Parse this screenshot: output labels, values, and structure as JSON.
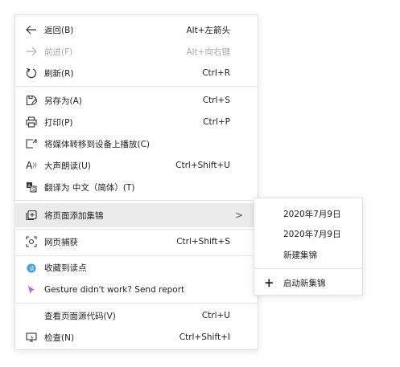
{
  "menu": {
    "back": {
      "label": "返回(B)",
      "shortcut": "Alt+左箭头"
    },
    "forward": {
      "label": "前进(F)",
      "shortcut": "Alt+向右键"
    },
    "refresh": {
      "label": "刷新(R)",
      "shortcut": "Ctrl+R"
    },
    "save_as": {
      "label": "另存为(A)",
      "shortcut": "Ctrl+S"
    },
    "print": {
      "label": "打印(P)",
      "shortcut": "Ctrl+P"
    },
    "cast": {
      "label": "将媒体转移到设备上播放(C)"
    },
    "read_aloud": {
      "label": "大声朗读(U)",
      "shortcut": "Ctrl+Shift+U"
    },
    "translate": {
      "label": "翻译为 中文（简体）(T)"
    },
    "add_to_collections": {
      "label": "将页面添加集锦",
      "chevron": ">"
    },
    "web_capture": {
      "label": "网页捕获",
      "shortcut": "Ctrl+Shift+S"
    },
    "collect_to_reading": {
      "label": "收藏到读点"
    },
    "gesture_report": {
      "label": "Gesture didn't work? Send report"
    },
    "view_source": {
      "label": "查看页面源代码(V)",
      "shortcut": "Ctrl+U"
    },
    "inspect": {
      "label": "检查(N)",
      "shortcut": "Ctrl+Shift+I"
    }
  },
  "submenu": {
    "items": [
      "2020年7月9日",
      "2020年7月9日",
      "新建集锦"
    ],
    "start_new": {
      "icon": "+",
      "label": "启动新集锦"
    }
  },
  "colors": {
    "reading_dot": "#3aa0e0",
    "gesture_icon": "#b06ad8",
    "highlight": "#eaeaea"
  }
}
